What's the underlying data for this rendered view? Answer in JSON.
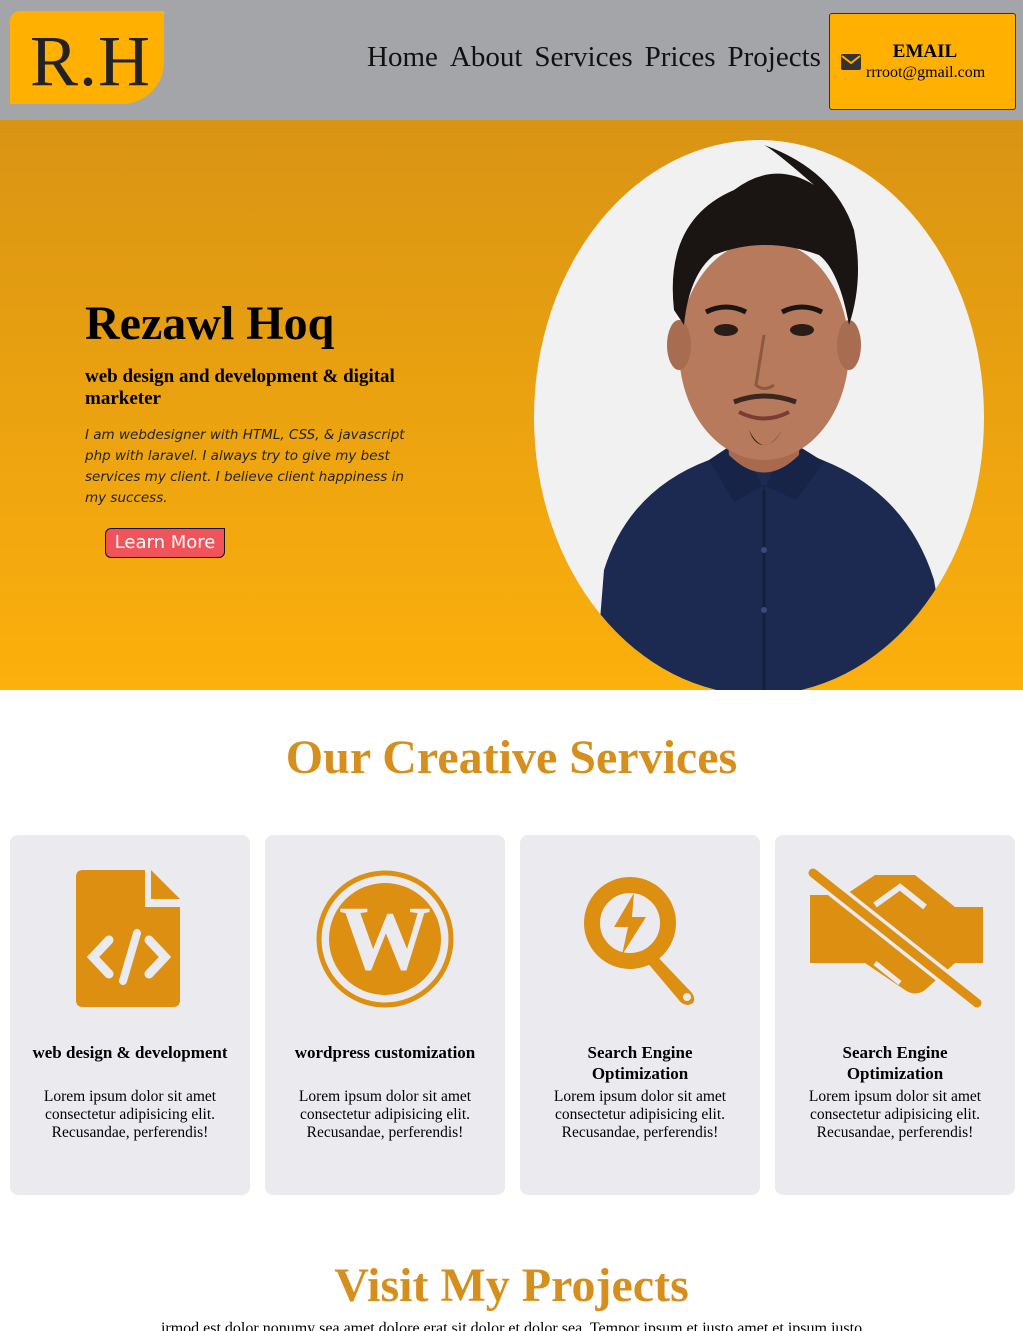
{
  "header": {
    "logo": "R.H",
    "nav": [
      "Home",
      "About",
      "Services",
      "Prices",
      "Projects"
    ],
    "email": {
      "title": "EMAIL",
      "address": "rrroot@gmail.com",
      "icon": "envelope-icon"
    }
  },
  "hero": {
    "name": "Rezawl Hoq",
    "role": "web design and development & digital marketer",
    "description": "I am webdesigner with HTML, CSS, & javascript php with laravel. I always try to give my best services my client. I believe client happiness in my success.",
    "button": "Learn More"
  },
  "services": {
    "title": "Our Creative Services",
    "cards": [
      {
        "icon": "code-file-icon",
        "title": "web design & development",
        "text": "Lorem ipsum dolor sit amet consectetur adipisicing elit. Recusandae, perferendis!"
      },
      {
        "icon": "wordpress-icon",
        "title": "wordpress customization",
        "text": "Lorem ipsum dolor sit amet consectetur adipisicing elit. Recusandae, perferendis!"
      },
      {
        "icon": "search-lightning-icon",
        "title": "Search Engine Optimization",
        "text": "Lorem ipsum dolor sit amet consectetur adipisicing elit. Recusandae, perferendis!"
      },
      {
        "icon": "handshake-slash-icon",
        "title": "Search Engine Optimization",
        "text": "Lorem ipsum dolor sit amet consectetur adipisicing elit. Recusandae, perferendis!"
      }
    ]
  },
  "projects": {
    "title": "Visit My Projects",
    "subtitle": "irmod est dolor nonumy sea amet dolore erat sit dolor et dolor sea. Tempor ipsum et justo amet et ipsum justo"
  },
  "colors": {
    "accent": "#ffb000",
    "heading": "#d68f1c",
    "button": "#f0535a",
    "header": "#a4a5a8",
    "card": "#ebebef"
  }
}
